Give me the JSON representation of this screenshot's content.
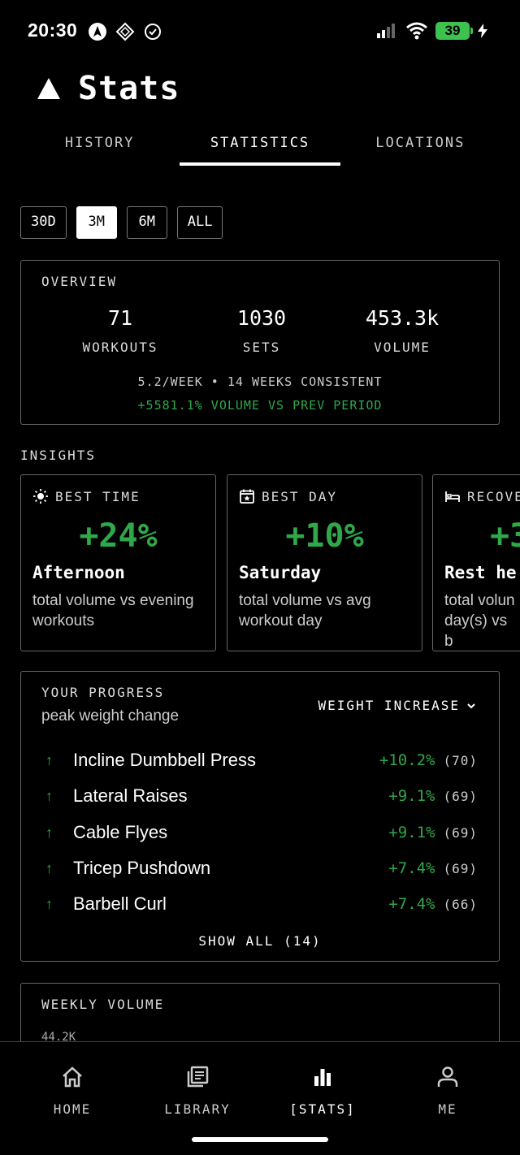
{
  "status": {
    "time": "20:30",
    "battery": "39"
  },
  "header": {
    "title": "Stats",
    "tabs": [
      {
        "label": "HISTORY"
      },
      {
        "label": "STATISTICS"
      },
      {
        "label": "LOCATIONS"
      }
    ],
    "active_tab": "STATISTICS"
  },
  "ranges": [
    {
      "label": "30D"
    },
    {
      "label": "3M"
    },
    {
      "label": "6M"
    },
    {
      "label": "ALL"
    }
  ],
  "active_range": "3M",
  "overview": {
    "label": "OVERVIEW",
    "stats": [
      {
        "value": "71",
        "label": "WORKOUTS"
      },
      {
        "value": "1030",
        "label": "SETS"
      },
      {
        "value": "453.3k",
        "label": "VOLUME"
      }
    ],
    "consistency": "5.2/WEEK • 14 WEEKS CONSISTENT",
    "change": "+5581.1% VOLUME VS PREV PERIOD"
  },
  "insights": {
    "heading": "INSIGHTS",
    "cards": [
      {
        "icon": "sun-icon",
        "title": "BEST TIME",
        "value": "+24%",
        "name": "Afternoon",
        "desc": "total volume vs evening workouts"
      },
      {
        "icon": "calendar-star-icon",
        "title": "BEST DAY",
        "value": "+10%",
        "name": "Saturday",
        "desc": "total volume vs avg workout day"
      },
      {
        "icon": "bed-icon",
        "title": "RECOVE",
        "value": "+3",
        "name": "Rest he",
        "desc": "total volun day(s) vs b"
      }
    ]
  },
  "progress": {
    "label": "YOUR PROGRESS",
    "subtitle": "peak weight change",
    "metric": "WEIGHT INCREASE",
    "rows": [
      {
        "name": "Incline Dumbbell Press",
        "change": "+10.2%",
        "count": "(70)"
      },
      {
        "name": "Lateral Raises",
        "change": "+9.1%",
        "count": "(69)"
      },
      {
        "name": "Cable Flyes",
        "change": "+9.1%",
        "count": "(69)"
      },
      {
        "name": "Tricep Pushdown",
        "change": "+7.4%",
        "count": "(69)"
      },
      {
        "name": "Barbell Curl",
        "change": "+7.4%",
        "count": "(66)"
      }
    ],
    "show_all": "SHOW ALL (14)"
  },
  "weekly": {
    "label": "WEEKLY VOLUME",
    "ymax": "44.2K"
  },
  "nav": [
    {
      "label": "HOME",
      "icon": "home-icon"
    },
    {
      "label": "LIBRARY",
      "icon": "library-icon"
    },
    {
      "label": "[STATS]",
      "icon": "bar-chart-icon"
    },
    {
      "label": "ME",
      "icon": "person-icon"
    }
  ],
  "colors": {
    "accent_green": "#2fa84a",
    "battery_green": "#3ec24f",
    "background": "#000000"
  }
}
